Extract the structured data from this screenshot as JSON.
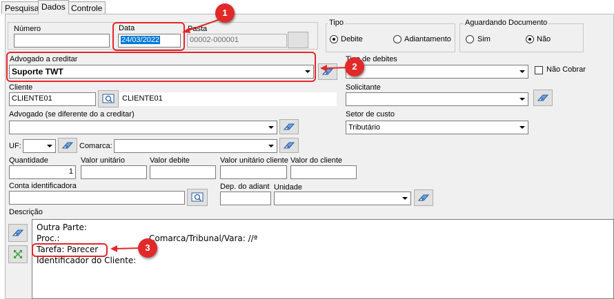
{
  "tabs": [
    {
      "label": "Pesquisa"
    },
    {
      "label": "Dados"
    },
    {
      "label": "Controle"
    }
  ],
  "numero": {
    "label": "Número",
    "value": ""
  },
  "data": {
    "label": "Data",
    "value": "24/03/2022"
  },
  "pasta": {
    "label": "Pasta",
    "value": "00002-000001"
  },
  "tipo": {
    "title": "Tipo",
    "options": [
      "Debite",
      "Adiantamento"
    ],
    "selected": "Debite"
  },
  "aguardando": {
    "title": "Aguardando Documento",
    "options": [
      "Sim",
      "Não"
    ],
    "selected": "Não"
  },
  "advogado_creditar": {
    "label": "Advogado a creditar",
    "value": "Suporte TWT"
  },
  "tipo_debites": {
    "label": "Tipo de debites",
    "value": ""
  },
  "nao_cobrar": {
    "label": "Não Cobrar",
    "checked": false
  },
  "cliente": {
    "label": "Cliente",
    "code": "CLIENTE01",
    "name": "CLIENTE01"
  },
  "solicitante": {
    "label": "Solicitante",
    "value": ""
  },
  "advogado_dif": {
    "label": "Advogado  (se diferente do a creditar)",
    "value": ""
  },
  "setor_custo": {
    "label": "Setor de custo",
    "value": "Tributário"
  },
  "uf": {
    "label": "UF:",
    "value": ""
  },
  "comarca": {
    "label": "Comarca:",
    "value": ""
  },
  "quantidade": {
    "label": "Quantidade",
    "value": "1"
  },
  "valor_unitario": {
    "label": "Valor unitário",
    "value": ""
  },
  "valor_debite": {
    "label": "Valor debite",
    "value": ""
  },
  "valor_unitario_cliente": {
    "label": "Valor unitário cliente",
    "value": ""
  },
  "valor_cliente": {
    "label": "Valor do cliente",
    "value": ""
  },
  "conta": {
    "label": "Conta identificadora",
    "value": ""
  },
  "dep_adiant": {
    "label": "Dep. do adiant",
    "value": ""
  },
  "unidade": {
    "label": "Unidade",
    "value": ""
  },
  "descricao": {
    "label": "Descrição",
    "lines": [
      "Outra Parte:",
      "Proc.:",
      "Comarca/Tribunal/Vara: //ª",
      "Tarefa: Parecer",
      "Identificador do Cliente:"
    ]
  },
  "annotations": [
    "1",
    "2",
    "3"
  ],
  "colors": {
    "highlight": "#e5252a",
    "selection": "#0078d7"
  }
}
